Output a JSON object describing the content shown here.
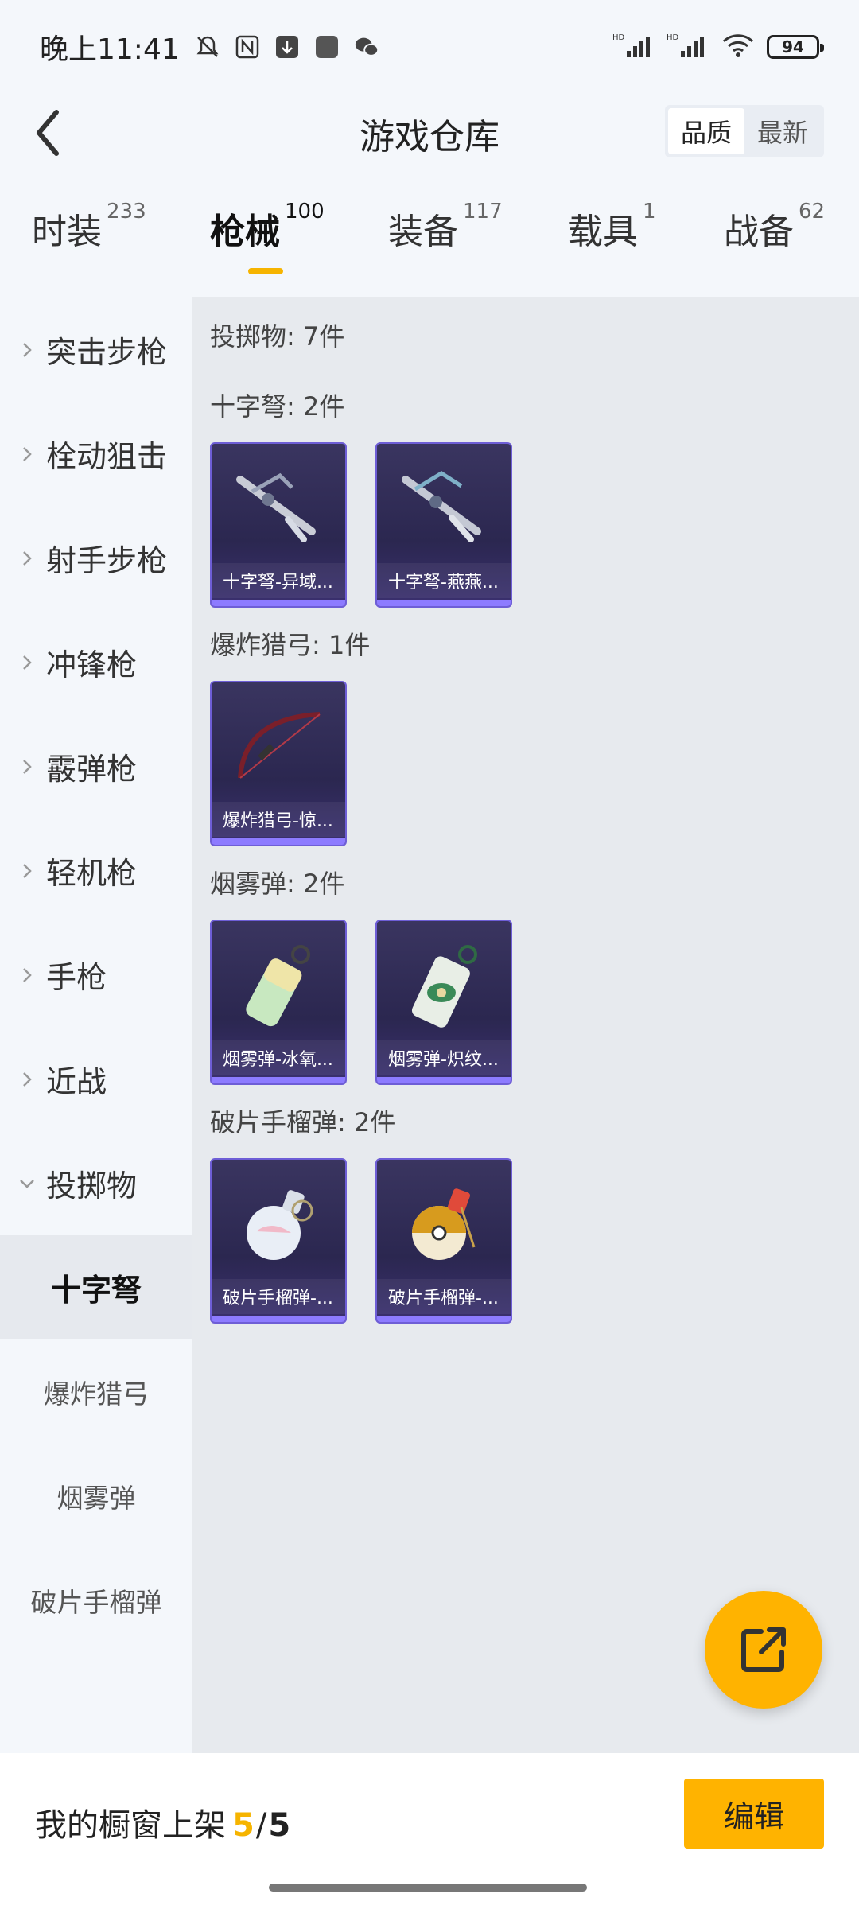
{
  "status_bar": {
    "time": "晚上11:41",
    "battery": "94",
    "icons_left": [
      "bell-off-icon",
      "nfc-icon",
      "download-icon",
      "app-icon",
      "wechat-icon"
    ],
    "icons_right": [
      "signal-hd-icon",
      "signal-hd-icon",
      "wifi-icon",
      "battery-icon"
    ]
  },
  "header": {
    "title": "游戏仓库",
    "sort_options": [
      "品质",
      "最新"
    ],
    "sort_selected": "品质"
  },
  "tabs": [
    {
      "label": "时装",
      "count": "233",
      "active": false
    },
    {
      "label": "枪械",
      "count": "100",
      "active": true
    },
    {
      "label": "装备",
      "count": "117",
      "active": false
    },
    {
      "label": "载具",
      "count": "1",
      "active": false
    },
    {
      "label": "战备",
      "count": "62",
      "active": false
    }
  ],
  "sidebar": {
    "categories": [
      "突击步枪",
      "栓动狙击",
      "射手步枪",
      "冲锋枪",
      "霰弹枪",
      "轻机枪",
      "手枪",
      "近战",
      "投掷物"
    ],
    "expanded": "投掷物",
    "subcategories": [
      "十字弩",
      "爆炸猎弓",
      "烟雾弹",
      "破片手榴弹"
    ],
    "sub_selected": "十字弩"
  },
  "content": {
    "total_label": "投掷物: 7件",
    "groups": [
      {
        "label": "十字弩: 2件",
        "items": [
          "十字弩-异域...",
          "十字弩-燕燕..."
        ]
      },
      {
        "label": "爆炸猎弓: 1件",
        "items": [
          "爆炸猎弓-惊..."
        ]
      },
      {
        "label": "烟雾弹: 2件",
        "items": [
          "烟雾弹-冰氧...",
          "烟雾弹-炽纹..."
        ]
      },
      {
        "label": "破片手榴弹: 2件",
        "items": [
          "破片手榴弹-...",
          "破片手榴弹-..."
        ]
      }
    ]
  },
  "footer": {
    "label": "我的橱窗上架",
    "count": "5",
    "slash": "/",
    "total": "5",
    "edit_label": "编辑"
  },
  "colors": {
    "accent": "#ffb300",
    "card_bg": "#2b2750",
    "quality_purple": "#8d7bff"
  }
}
